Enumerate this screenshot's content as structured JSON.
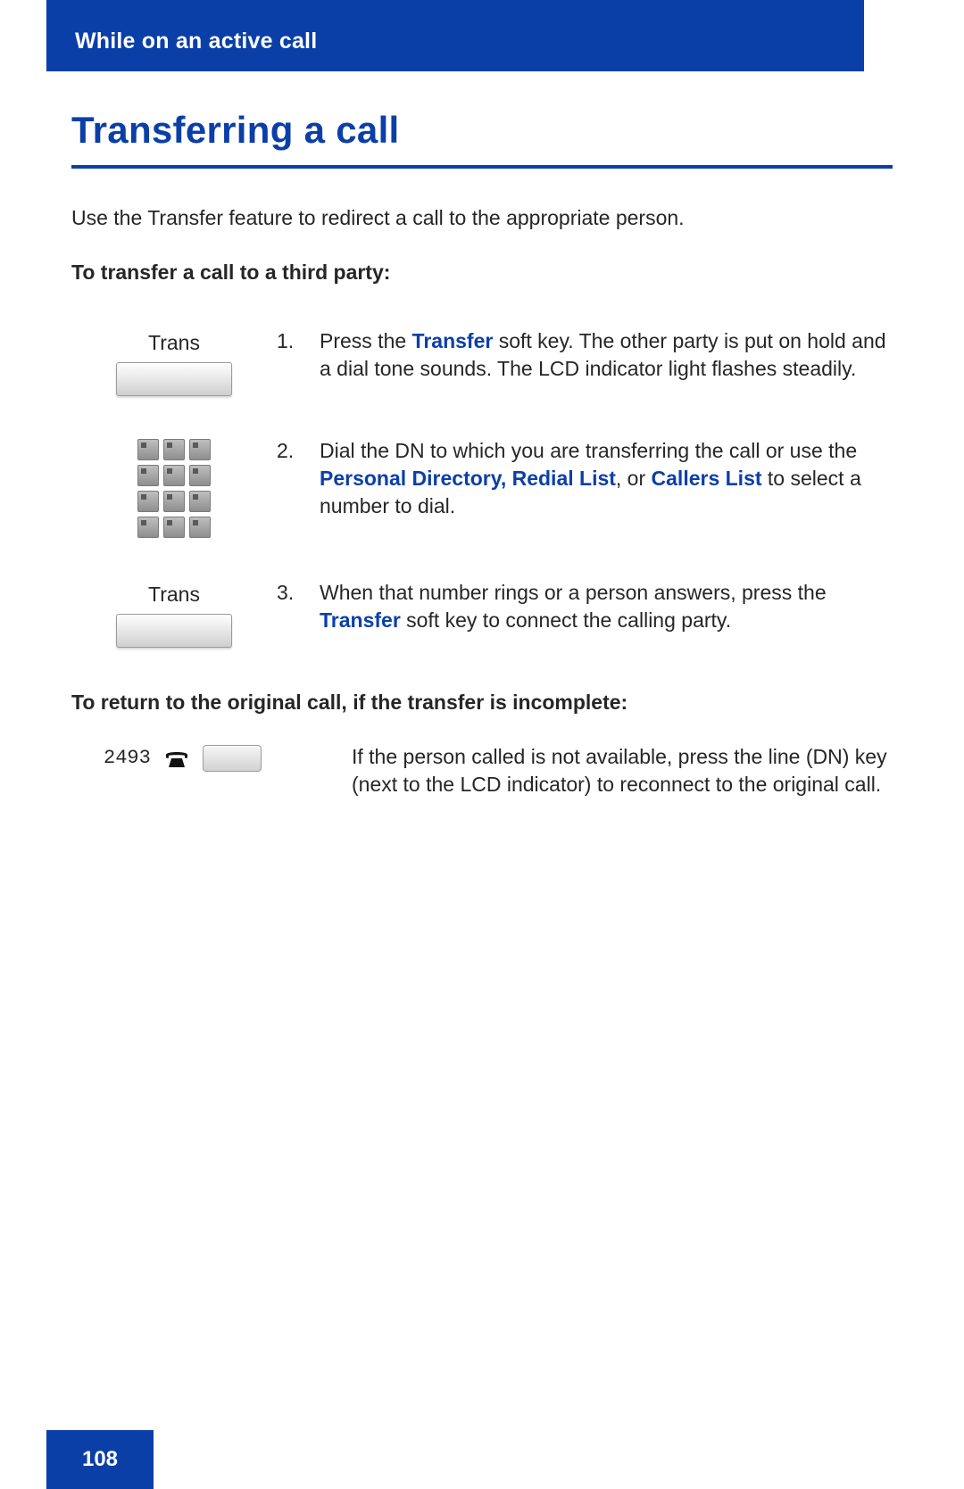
{
  "colors": {
    "brand_blue": "#0b3fa8",
    "link_blue": "#0b3fa8"
  },
  "header": {
    "section": "While on an active call"
  },
  "title": "Transferring a call",
  "intro": "Use the Transfer feature to redirect a call to the appropriate person.",
  "sub1": "To transfer a call to a third party:",
  "softkey_label": "Trans",
  "steps": {
    "1": {
      "num": "1.",
      "pre": "Press the ",
      "link1": "Transfer",
      "post": " soft key. The other party is put on hold and a dial tone sounds. The LCD indicator light flashes steadily."
    },
    "2": {
      "num": "2.",
      "pre": "Dial the DN to which you are transferring the call or use the ",
      "link1": "Personal Directory, Redial List",
      "mid": ", or ",
      "link2": "Callers List",
      "post": " to select a number to dial."
    },
    "3": {
      "num": "3.",
      "pre": "When that number rings or a person answers, press the ",
      "link1": "Transfer",
      "post": " soft key to connect the calling party."
    }
  },
  "sub2": "To return to the original call, if the transfer is incomplete:",
  "dn": {
    "number": "2493",
    "text": "If the person called is not available, press the line (DN) key (next to the LCD indicator) to reconnect to the original call."
  },
  "page_number": "108"
}
